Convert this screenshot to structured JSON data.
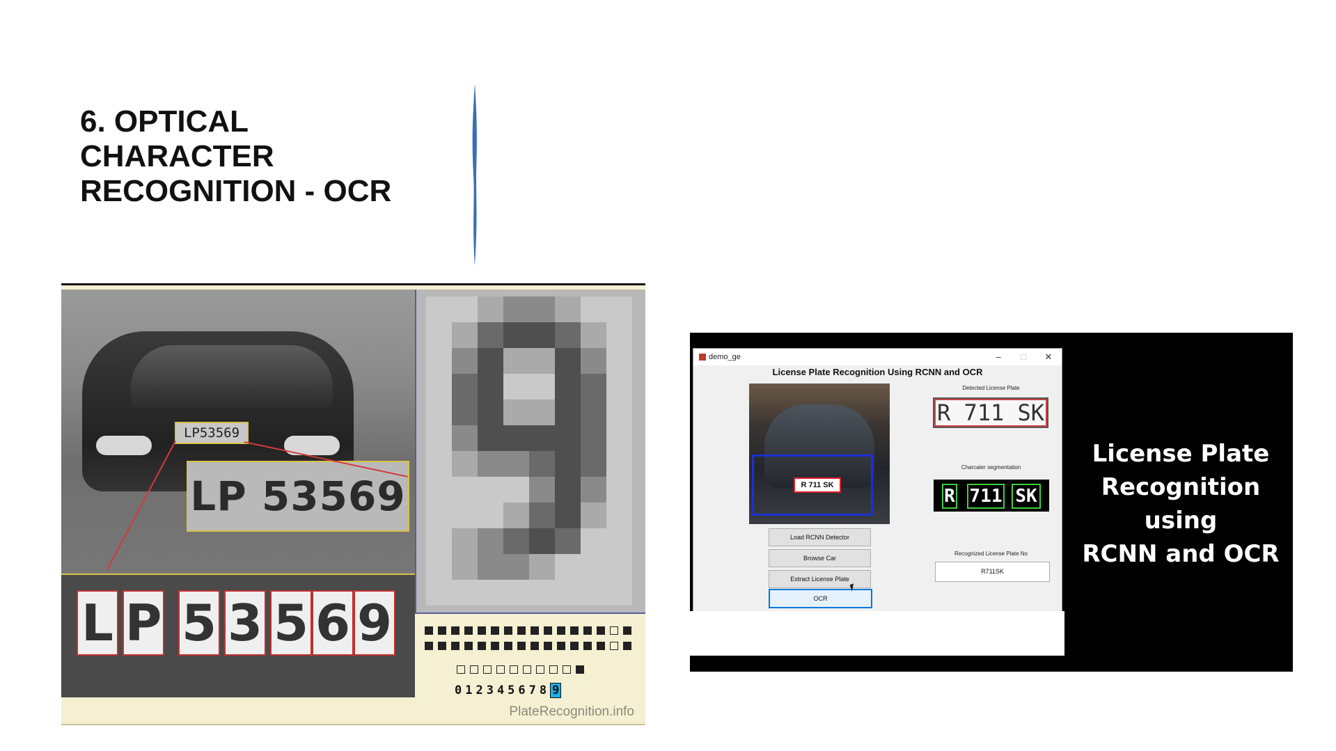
{
  "slide": {
    "title": "6. OPTICAL\nCHARACTER\nRECOGNITION - OCR",
    "accent_color": "#3a6fb5"
  },
  "left_figure": {
    "plate_small": "LP53569",
    "plate_large": "LP 53569",
    "segmented_chars": [
      "L",
      "P",
      "5",
      "3",
      "5",
      "6",
      "9"
    ],
    "digit_row": "012345678",
    "highlighted_digit": "9",
    "credit": "PlateRecognition.info"
  },
  "app_window": {
    "window_title": "demo_ge",
    "controls": {
      "minimize": "–",
      "maximize": "□",
      "close": "✕"
    },
    "heading": "License Plate Recognition Using RCNN and OCR",
    "car_plate_text": "R 711 SK",
    "detected_label": "Detected License Plate",
    "detected_plate": "R 711 SK",
    "segmentation_label": "Charcater segmentation",
    "segmented": [
      "R",
      "711",
      "SK"
    ],
    "buttons": {
      "load": "Load RCNN Detector",
      "browse": "Browse Car",
      "extract": "Extract License Plate",
      "ocr": "OCR"
    },
    "recognized_label": "Recognized License Plate No",
    "recognized_value": "R711SK"
  },
  "side_caption": "License Plate\nRecognition\nusing\nRCNN and OCR"
}
